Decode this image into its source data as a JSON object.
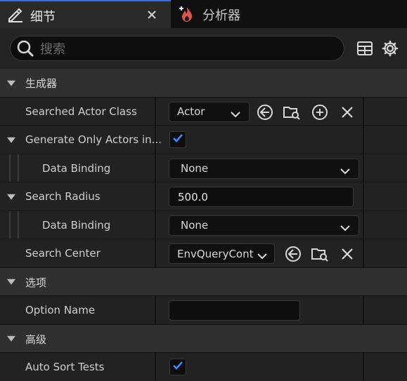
{
  "tabs": {
    "details_label": "细节",
    "profiler_label": "分析器"
  },
  "search": {
    "placeholder": "搜索"
  },
  "categories": {
    "spawner": "生成器",
    "options": "选项",
    "advanced": "高级"
  },
  "properties": {
    "searched_actor_class": {
      "label": "Searched Actor Class",
      "value": "Actor"
    },
    "generate_only_actors": {
      "label": "Generate Only Actors in...",
      "checked": true
    },
    "data_binding_1": {
      "label": "Data Binding",
      "value": "None"
    },
    "search_radius": {
      "label": "Search Radius",
      "value": "500.0"
    },
    "data_binding_2": {
      "label": "Data Binding",
      "value": "None"
    },
    "search_center": {
      "label": "Search Center",
      "value": "EnvQueryCont"
    },
    "option_name": {
      "label": "Option Name",
      "value": ""
    },
    "auto_sort_tests": {
      "label": "Auto Sort Tests",
      "checked": true
    }
  },
  "colors": {
    "accent": "#3b6fd1",
    "checkmark": "#3d8bff",
    "flame": "#e0524a"
  }
}
